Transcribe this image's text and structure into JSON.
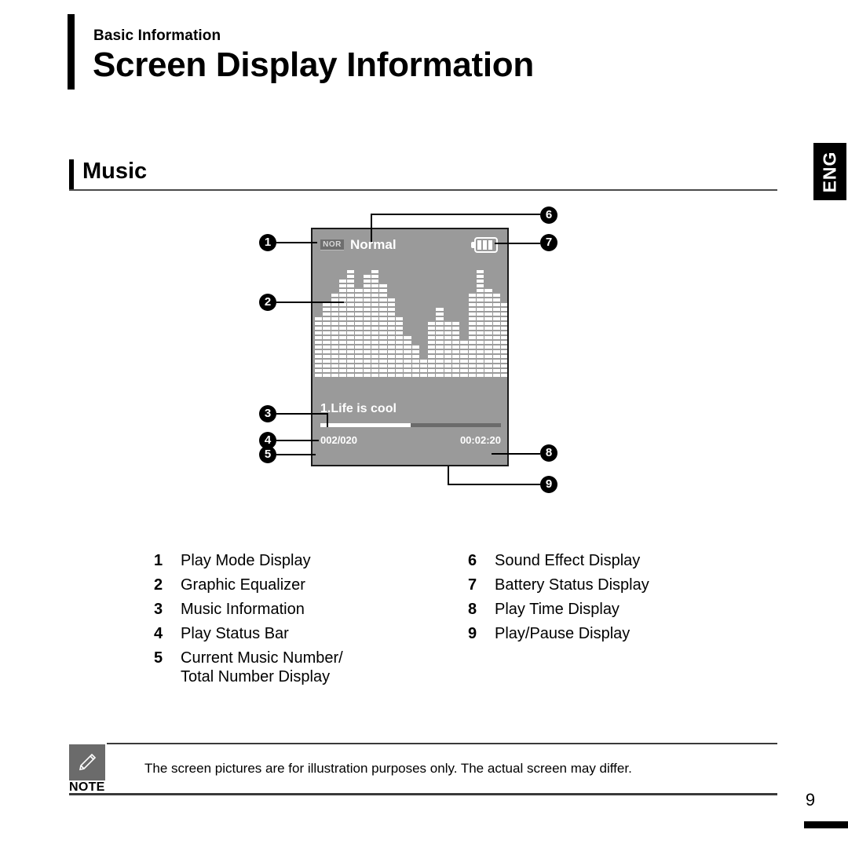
{
  "header": {
    "eyebrow": "Basic Information",
    "title": "Screen Display Information"
  },
  "language_tab": {
    "label": "ENG"
  },
  "section": {
    "title": "Music"
  },
  "device_screen": {
    "play_mode_icon": "NOR",
    "mode_label": "Normal",
    "battery_icon": "battery-icon",
    "battery_cells": 3,
    "track_title": "1.Life is cool",
    "progress_percent": 50,
    "track_number": "002/020",
    "play_time": "00:02:20",
    "equalizer": {
      "bar_count": 24,
      "max_segments": 24,
      "segments": [
        13,
        16,
        18,
        21,
        23,
        19,
        22,
        23,
        20,
        17,
        13,
        9,
        7,
        4,
        12,
        15,
        12,
        12,
        8,
        18,
        23,
        19,
        18,
        16
      ]
    }
  },
  "callouts": [
    {
      "number": "1",
      "target": "play-mode-display"
    },
    {
      "number": "2",
      "target": "graphic-equalizer"
    },
    {
      "number": "3",
      "target": "music-information"
    },
    {
      "number": "4",
      "target": "play-status-bar"
    },
    {
      "number": "5",
      "target": "current-music-number"
    },
    {
      "number": "6",
      "target": "sound-effect-display"
    },
    {
      "number": "7",
      "target": "battery-status-display"
    },
    {
      "number": "8",
      "target": "play-time-display"
    },
    {
      "number": "9",
      "target": "play-pause-display"
    }
  ],
  "legend": {
    "left": [
      {
        "num": "1",
        "label": "Play Mode Display",
        "label2": ""
      },
      {
        "num": "2",
        "label": "Graphic Equalizer",
        "label2": ""
      },
      {
        "num": "3",
        "label": "Music Information",
        "label2": ""
      },
      {
        "num": "4",
        "label": "Play Status Bar",
        "label2": ""
      },
      {
        "num": "5",
        "label": "Current Music Number/",
        "label2": "Total Number Display"
      }
    ],
    "right": [
      {
        "num": "6",
        "label": "Sound Effect Display"
      },
      {
        "num": "7",
        "label": "Battery Status Display"
      },
      {
        "num": "8",
        "label": "Play Time Display"
      },
      {
        "num": "9",
        "label": "Play/Pause Display"
      }
    ]
  },
  "note": {
    "label": "NOTE",
    "icon": "pencil-icon",
    "text": "The screen pictures are for illustration purposes only. The actual screen may differ."
  },
  "footer": {
    "page_number": "9"
  }
}
